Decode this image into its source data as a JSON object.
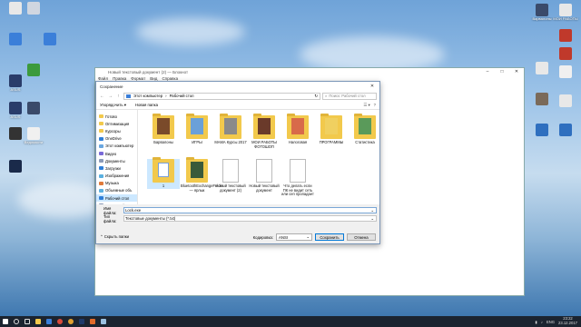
{
  "desktop": {
    "left_icons": [
      {
        "label": "",
        "color": "#e8e8e8"
      },
      {
        "label": "",
        "color": "#d0d6e0"
      },
      {
        "label": "",
        "color": "#3b7fd9"
      },
      {
        "label": "",
        "color": "#3b7fd9"
      },
      {
        "label": "ASUS",
        "color": "#2a3c6a"
      },
      {
        "label": "",
        "color": "#3c9a3c"
      },
      {
        "label": "ASUS",
        "color": "#2a3c6a"
      },
      {
        "label": "",
        "color": "#3a4a6a"
      },
      {
        "label": "",
        "color": "#333333"
      },
      {
        "label": "Ведомости",
        "color": "#f0f0f0"
      },
      {
        "label": "",
        "color": "#1a2a4a"
      }
    ],
    "right_icons": [
      {
        "label": "Варвалоны",
        "color": "#3a4a6a"
      },
      {
        "label": "МОИ РАБОТЫ",
        "color": "#e8e8e8"
      },
      {
        "label": "",
        "color": "#c0392b"
      },
      {
        "label": "",
        "color": "#c0392b"
      },
      {
        "label": "",
        "color": "#e8e8e8"
      },
      {
        "label": "",
        "color": "#f0f0f0"
      },
      {
        "label": "",
        "color": "#7a6a5a"
      },
      {
        "label": "",
        "color": "#e8e8e8"
      },
      {
        "label": "",
        "color": "#2f6fbf"
      },
      {
        "label": "",
        "color": "#2f6fbf"
      }
    ]
  },
  "notepad": {
    "title": "Новый текстовый документ (2) — Блокнот",
    "menu": [
      "Файл",
      "Правка",
      "Формат",
      "Вид",
      "Справка"
    ],
    "controls": [
      "–",
      "□",
      "✕"
    ]
  },
  "dialog": {
    "title": "Сохранение",
    "close": "✕",
    "address": {
      "back": "←",
      "forward": "→",
      "up": "↑",
      "crumbs": [
        "Этот компьютер",
        "Рабочий стол"
      ],
      "refresh": "↻",
      "search_placeholder": "Поиск: Рабочий стол"
    },
    "toolbar": {
      "organize": "Упорядочить ▾",
      "new_folder": "Новая папка",
      "view": "☰ ▾",
      "help": "?"
    },
    "nav": [
      {
        "label": "Готово",
        "color": "#f2c94c",
        "selected": false
      },
      {
        "label": "Оптимизация",
        "color": "#f2c94c",
        "selected": false
      },
      {
        "label": "Курсоры",
        "color": "#f2c94c",
        "selected": false
      },
      {
        "label": "OneDrive",
        "color": "#2f7fd8",
        "selected": false
      },
      {
        "label": "Этот компьютер",
        "color": "#6aa7e0",
        "selected": false
      },
      {
        "label": "Видео",
        "color": "#7a6ad8",
        "selected": false
      },
      {
        "label": "Документы",
        "color": "#8a9ab8",
        "selected": false
      },
      {
        "label": "Загрузки",
        "color": "#2f7fd8",
        "selected": false
      },
      {
        "label": "Изображения",
        "color": "#5ab0e0",
        "selected": false
      },
      {
        "label": "Музыка",
        "color": "#e07a3a",
        "selected": false
      },
      {
        "label": "Объемные объ",
        "color": "#5ab0e0",
        "selected": false
      },
      {
        "label": "Рабочий стол",
        "color": "#2f7fd8",
        "selected": true
      },
      {
        "label": "Локальный дис",
        "color": "#8a9ab8",
        "selected": false
      }
    ],
    "files": [
      {
        "name": "Барвалоны",
        "kind": "folder-photo",
        "accent": "#7a4a2a"
      },
      {
        "name": "ИГРЫ",
        "kind": "folder",
        "accent": "#6aa0d8"
      },
      {
        "name": "МАМА Курсы 2017",
        "kind": "folder",
        "accent": "#8a8a8a"
      },
      {
        "name": "МОИ РАБОТЫ ФОТОШОП",
        "kind": "folder-photo",
        "accent": "#6a3a2a"
      },
      {
        "name": "Налоговая",
        "kind": "folder",
        "accent": "#d86a4a"
      },
      {
        "name": "ПРОГРАММЫ",
        "kind": "folder",
        "accent": "#f0d060"
      },
      {
        "name": "Статистика",
        "kind": "folder",
        "accent": "#5a9a5a"
      },
      {
        "name": "1",
        "kind": "selected-doc",
        "accent": "#7aa0d8"
      },
      {
        "name": "BluetoothExchangeFolder — ярлык",
        "kind": "folder-photo",
        "accent": "#3a5a3a"
      },
      {
        "name": "Новый текстовый документ (2)",
        "kind": "doc",
        "accent": "#ffffff"
      },
      {
        "name": "Новый текстовый документ",
        "kind": "doc",
        "accent": "#ffffff"
      },
      {
        "name": "Что делать если ПК не видит сеть или сеп пропадает",
        "kind": "doc",
        "accent": "#ffffff"
      }
    ],
    "filename_label": "Имя файла:",
    "filename_value": "Lock.exe",
    "filetype_label": "Тип файла:",
    "filetype_value": "Текстовые документы (*.txt)",
    "hide_folders": "⌃ Скрыть папки",
    "encoding_label": "Кодировка:",
    "encoding_value": "ANSI",
    "save": "Сохранить",
    "cancel": "Отмена"
  },
  "taskbar": {
    "lang": "ENG",
    "time": "23:22",
    "date": "23.12.2017"
  }
}
